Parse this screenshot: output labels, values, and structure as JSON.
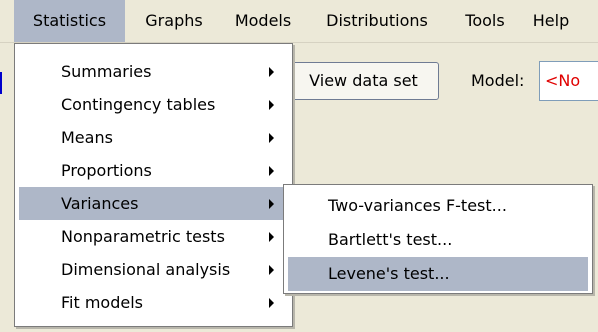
{
  "menubar": {
    "items": [
      "Statistics",
      "Graphs",
      "Models",
      "Distributions",
      "Tools",
      "Help"
    ]
  },
  "toolbar": {
    "view_data_set_label": "View data set",
    "model_label": "Model:",
    "model_value": "<No"
  },
  "statistics_menu": {
    "items": [
      {
        "label": "Summaries"
      },
      {
        "label": "Contingency tables"
      },
      {
        "label": "Means"
      },
      {
        "label": "Proportions"
      },
      {
        "label": "Variances"
      },
      {
        "label": "Nonparametric tests"
      },
      {
        "label": "Dimensional analysis"
      },
      {
        "label": "Fit models"
      }
    ]
  },
  "variances_submenu": {
    "items": [
      {
        "label": "Two-variances F-test..."
      },
      {
        "label": "Bartlett's test..."
      },
      {
        "label": "Levene's test..."
      }
    ]
  },
  "colors": {
    "menu_background": "#ece9d8",
    "highlight": "#aeb7c8",
    "model_text": "#e00000"
  },
  "icons": [
    "submenu-arrow-icon"
  ]
}
